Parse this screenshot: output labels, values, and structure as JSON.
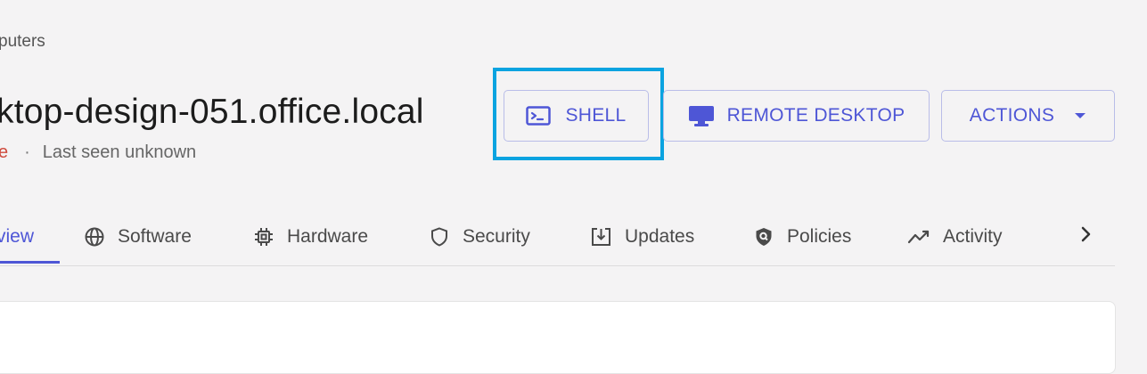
{
  "breadcrumb": {
    "text": "puters"
  },
  "header": {
    "title": "ktop-design-051.office.local",
    "status": "e",
    "separator": "·",
    "last_seen": "Last seen unknown"
  },
  "toolbar": {
    "shell_label": "SHELL",
    "shell_icon": "terminal-icon",
    "remote_label": "REMOTE DESKTOP",
    "remote_icon": "monitor-icon",
    "actions_label": "ACTIONS",
    "actions_icon": "caret-down-icon"
  },
  "tabs": [
    {
      "label": "view",
      "icon": "",
      "active": true
    },
    {
      "label": "Software",
      "icon": "globe-icon"
    },
    {
      "label": "Hardware",
      "icon": "chip-icon"
    },
    {
      "label": "Security",
      "icon": "shield-icon"
    },
    {
      "label": "Updates",
      "icon": "download-icon"
    },
    {
      "label": "Policies",
      "icon": "shield-search-icon"
    },
    {
      "label": "Activity",
      "icon": "trend-icon"
    }
  ],
  "card": {
    "heading": ""
  },
  "colors": {
    "accent": "#4e56d6",
    "status_offline": "#cf4b3e",
    "highlight": "#0aa3e0",
    "background": "#f4f3f4"
  }
}
